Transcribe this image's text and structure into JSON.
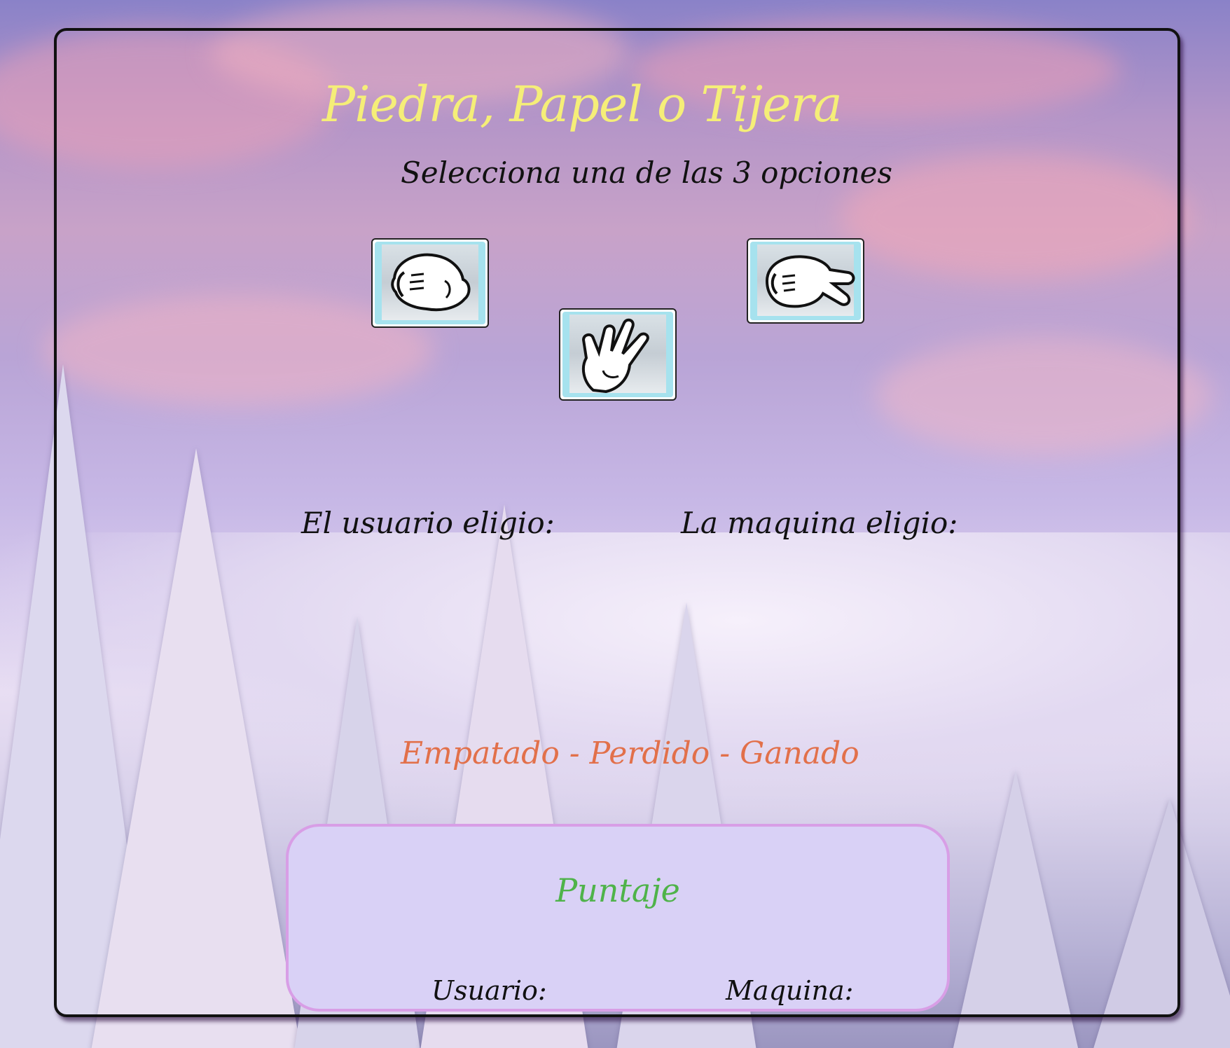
{
  "game": {
    "title": "Piedra, Papel o Tijera",
    "instruction": "Selecciona una de las 3 opciones"
  },
  "choices": [
    {
      "id": "piedra",
      "icon": "fist-hand-icon"
    },
    {
      "id": "papel",
      "icon": "open-hand-icon"
    },
    {
      "id": "tijera",
      "icon": "scissors-hand-icon"
    }
  ],
  "selection": {
    "user_label": "El usuario eligio:",
    "machine_label": "La maquina eligio:"
  },
  "result": {
    "text": "Empatado - Perdido - Ganado",
    "color": "#e2704a"
  },
  "score": {
    "title": "Puntaje",
    "user_label": "Usuario:",
    "machine_label": "Maquina:"
  },
  "colors": {
    "title": "#f5ee78",
    "score_title": "#4fb34a",
    "score_panel": "#d9d1f6",
    "score_border": "#d89ee6",
    "choice_bg": "#a6e2ee"
  }
}
